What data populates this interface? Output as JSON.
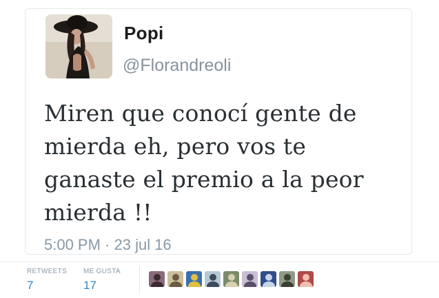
{
  "tweet": {
    "display_name": "Popi",
    "handle": "@Florandreoli",
    "text_lines": [
      "Miren que conocí gente de",
      "mierda eh, pero vos te",
      "ganaste el premio a la peor",
      "mierda !!"
    ],
    "timestamp": "5:00 PM · 23 jul 16"
  },
  "stats": {
    "retweets_label": "RETWEETS",
    "retweets_count": "7",
    "likes_label": "ME GUSTA",
    "likes_count": "17"
  },
  "liker_avatars": [
    {
      "name": "liker-avatar",
      "bg": "#8a6b7b",
      "fg": "#3b2a30"
    },
    {
      "name": "liker-avatar",
      "bg": "#cdbf9c",
      "fg": "#6b5a44"
    },
    {
      "name": "liker-avatar",
      "bg": "#3a6fb0",
      "fg": "#e0c040"
    },
    {
      "name": "liker-avatar",
      "bg": "#b8c9d6",
      "fg": "#3d4a5a"
    },
    {
      "name": "liker-avatar",
      "bg": "#7a8a6a",
      "fg": "#d8d0b0"
    },
    {
      "name": "liker-avatar",
      "bg": "#c6bfd2",
      "fg": "#5a4f6a"
    },
    {
      "name": "liker-avatar",
      "bg": "#2e4d8a",
      "fg": "#c8d4e8"
    },
    {
      "name": "liker-avatar",
      "bg": "#8f9a86",
      "fg": "#3a4030"
    },
    {
      "name": "liker-avatar",
      "bg": "#b04a4a",
      "fg": "#f0c0b0"
    }
  ],
  "colors": {
    "text": "#292f33",
    "muted": "#8899a6",
    "link": "#3b84c0",
    "border": "#e1e8ed"
  }
}
